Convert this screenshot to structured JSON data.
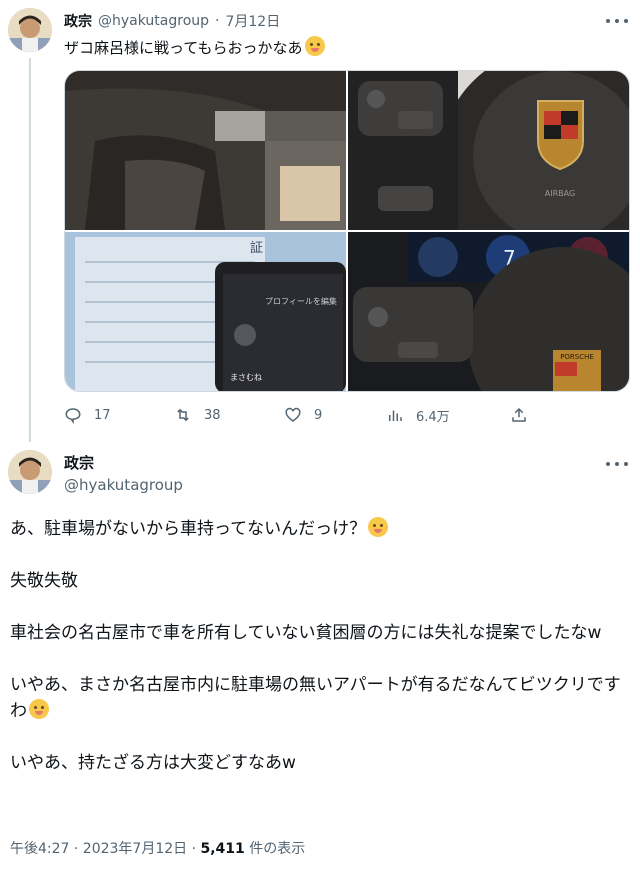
{
  "tweet1": {
    "name": "政宗",
    "handle": "@hyakutagroup",
    "date": "7月12日",
    "text": "ザコ麻呂様に戦ってもらおっかなあ",
    "actions": {
      "reply_count": "17",
      "retweet_count": "38",
      "like_count": "9",
      "view_count": "6.4万"
    }
  },
  "tweet2": {
    "name": "政宗",
    "handle": "@hyakutagroup",
    "paragraphs": [
      "あ、駐車場がないから車持ってないんだっけ？",
      "失敬失敬",
      "車社会の名古屋市で車を所有していない貧困層の方には失礼な提案でしたなw",
      "いやあ、まさか名古屋市内に駐車場の無いアパートが有るだなんてビツクリですわ",
      "いやあ、持たざる方は大変どすなあw"
    ],
    "time": "午後4:27 · 2023年7月12日 · ",
    "views_number": "5,411",
    "views_label": " 件の表示"
  },
  "images": {
    "phone_caption": "プロフィールを編集",
    "phone_name": "まさむね",
    "document_title": "証",
    "badge_text": "PORSCHE",
    "wheel_text": "AIRBAG",
    "dashboard_gear": "7"
  },
  "colors": {
    "text_primary": "#0f1419",
    "text_secondary": "#536471",
    "border": "#cfd9de"
  }
}
